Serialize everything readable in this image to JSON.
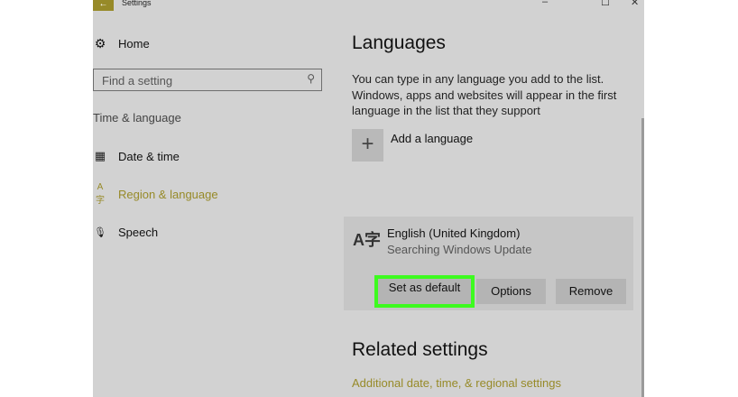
{
  "window": {
    "title": "Settings",
    "back_glyph": "←",
    "controls": [
      "–",
      "☐",
      "✕"
    ]
  },
  "nav": {
    "home": {
      "label": "Home",
      "icon": "gear-icon",
      "glyph": "⚙"
    },
    "search": {
      "placeholder": "Find a setting",
      "icon": "search-icon",
      "glyph": "⚲"
    },
    "section": "Time & language",
    "items": [
      {
        "label": "Date & time",
        "icon": "calendar-clock-icon",
        "glyph": "▦",
        "active": false
      },
      {
        "label": "Region & language",
        "icon": "language-icon",
        "glyph": "A字",
        "active": true
      },
      {
        "label": "Speech",
        "icon": "microphone-icon",
        "glyph": "🎙",
        "active": false
      }
    ]
  },
  "content": {
    "heading": "Languages",
    "description": "You can type in any language you add to the list. Windows, apps and websites will appear in the first language in the list that they support",
    "add_language": {
      "label": "Add a language",
      "glyph": "+"
    },
    "language_entry": {
      "icon_glyph": "A字",
      "name": "English (United Kingdom)",
      "status": "Searching Windows Update",
      "buttons": {
        "set_default": "Set as default",
        "options": "Options",
        "remove": "Remove"
      }
    },
    "related_heading": "Related settings",
    "related_link": "Additional date, time, & regional settings"
  },
  "colors": {
    "accent": "#978a28",
    "highlight": "#3dfb1f",
    "window_bg": "#d2d2d2",
    "panel_bg": "#c6c6c6"
  }
}
